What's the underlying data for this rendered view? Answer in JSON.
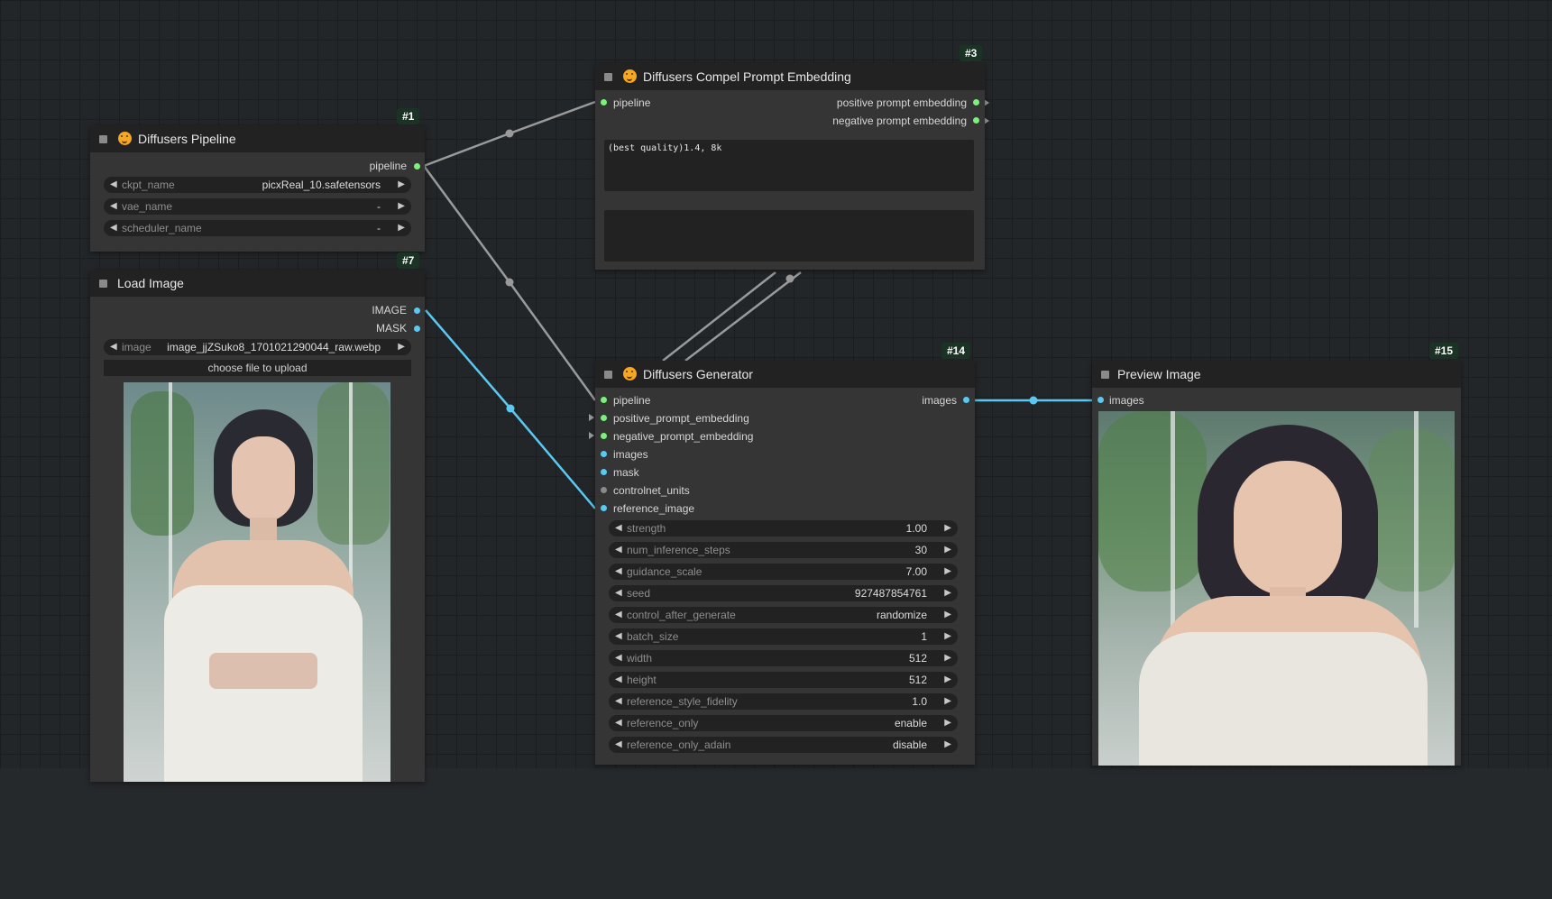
{
  "colors": {
    "canvas_bg": "#232629",
    "node_bg": "#353535",
    "node_header_bg": "#222222",
    "widget_bg": "#222222",
    "badge_bg": "#1a3325",
    "link_pipeline": "#9a9a9a",
    "link_image": "#5ac8f0",
    "slot_green": "#7bf07b",
    "slot_blue": "#5ac8f0"
  },
  "nodes": {
    "pipeline": {
      "id_badge": "#1",
      "title": "Diffusers Pipeline",
      "icon": "hugging-face-emoji-icon",
      "outputs": [
        "pipeline"
      ],
      "widgets": [
        {
          "label": "ckpt_name",
          "value": "picxReal_10.safetensors"
        },
        {
          "label": "vae_name",
          "value": "-"
        },
        {
          "label": "scheduler_name",
          "value": "-"
        }
      ]
    },
    "load_image": {
      "id_badge": "#7",
      "title": "Load Image",
      "outputs": [
        "IMAGE",
        "MASK"
      ],
      "widgets": [
        {
          "label": "image",
          "value": "image_jjZSuko8_1701021290044_raw.webp"
        }
      ],
      "upload_label": "choose file to upload"
    },
    "compel": {
      "id_badge": "#3",
      "title": "Diffusers Compel Prompt Embedding",
      "icon": "hugging-face-emoji-icon",
      "inputs": [
        "pipeline"
      ],
      "outputs": [
        "positive prompt embedding",
        "negative prompt embedding"
      ],
      "positive_text": "(best quality)1.4, 8k",
      "negative_text": ""
    },
    "generator": {
      "id_badge": "#14",
      "title": "Diffusers Generator",
      "icon": "hugging-face-emoji-icon",
      "inputs": [
        "pipeline",
        "positive_prompt_embedding",
        "negative_prompt_embedding",
        "images",
        "mask",
        "controlnet_units",
        "reference_image"
      ],
      "outputs": [
        "images"
      ],
      "widgets": [
        {
          "label": "strength",
          "value": "1.00"
        },
        {
          "label": "num_inference_steps",
          "value": "30"
        },
        {
          "label": "guidance_scale",
          "value": "7.00"
        },
        {
          "label": "seed",
          "value": "927487854761"
        },
        {
          "label": "control_after_generate",
          "value": "randomize"
        },
        {
          "label": "batch_size",
          "value": "1"
        },
        {
          "label": "width",
          "value": "512"
        },
        {
          "label": "height",
          "value": "512"
        },
        {
          "label": "reference_style_fidelity",
          "value": "1.0"
        },
        {
          "label": "reference_only",
          "value": "enable"
        },
        {
          "label": "reference_only_adain",
          "value": "disable"
        }
      ]
    },
    "preview": {
      "id_badge": "#15",
      "title": "Preview Image",
      "inputs": [
        "images"
      ]
    }
  }
}
